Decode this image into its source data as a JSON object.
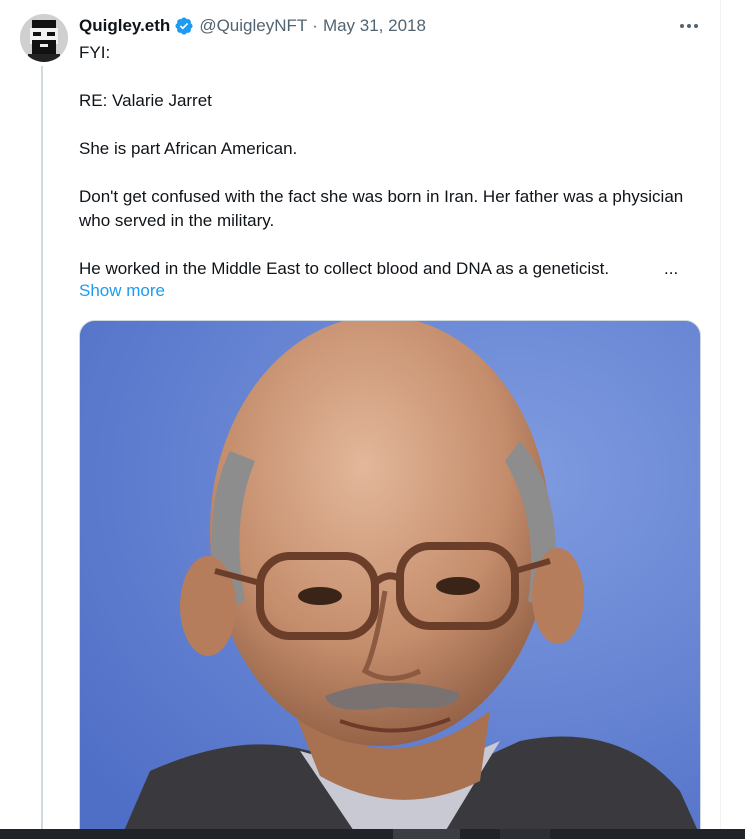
{
  "tweet": {
    "display_name": "Quigley.eth",
    "handle": "@QuigleyNFT",
    "separator": "·",
    "date": "May 31, 2018",
    "more_icon": "more-horizontal-icon",
    "verified_icon": "verified-badge-icon",
    "paragraphs": [
      "FYI:",
      "RE: Valarie Jarret",
      "She is part African American.",
      "Don't get confused with the fact she was born in Iran. Her father was a physician who served in the military.",
      "He worked in the Middle East to collect blood and DNA as a geneticist."
    ],
    "ellipsis": "...",
    "show_more": "Show more"
  },
  "colors": {
    "text": "#0f1419",
    "secondary": "#536471",
    "link": "#1d9bf0",
    "verified": "#1d9bf0",
    "photo_background": "#5f7fd0"
  }
}
